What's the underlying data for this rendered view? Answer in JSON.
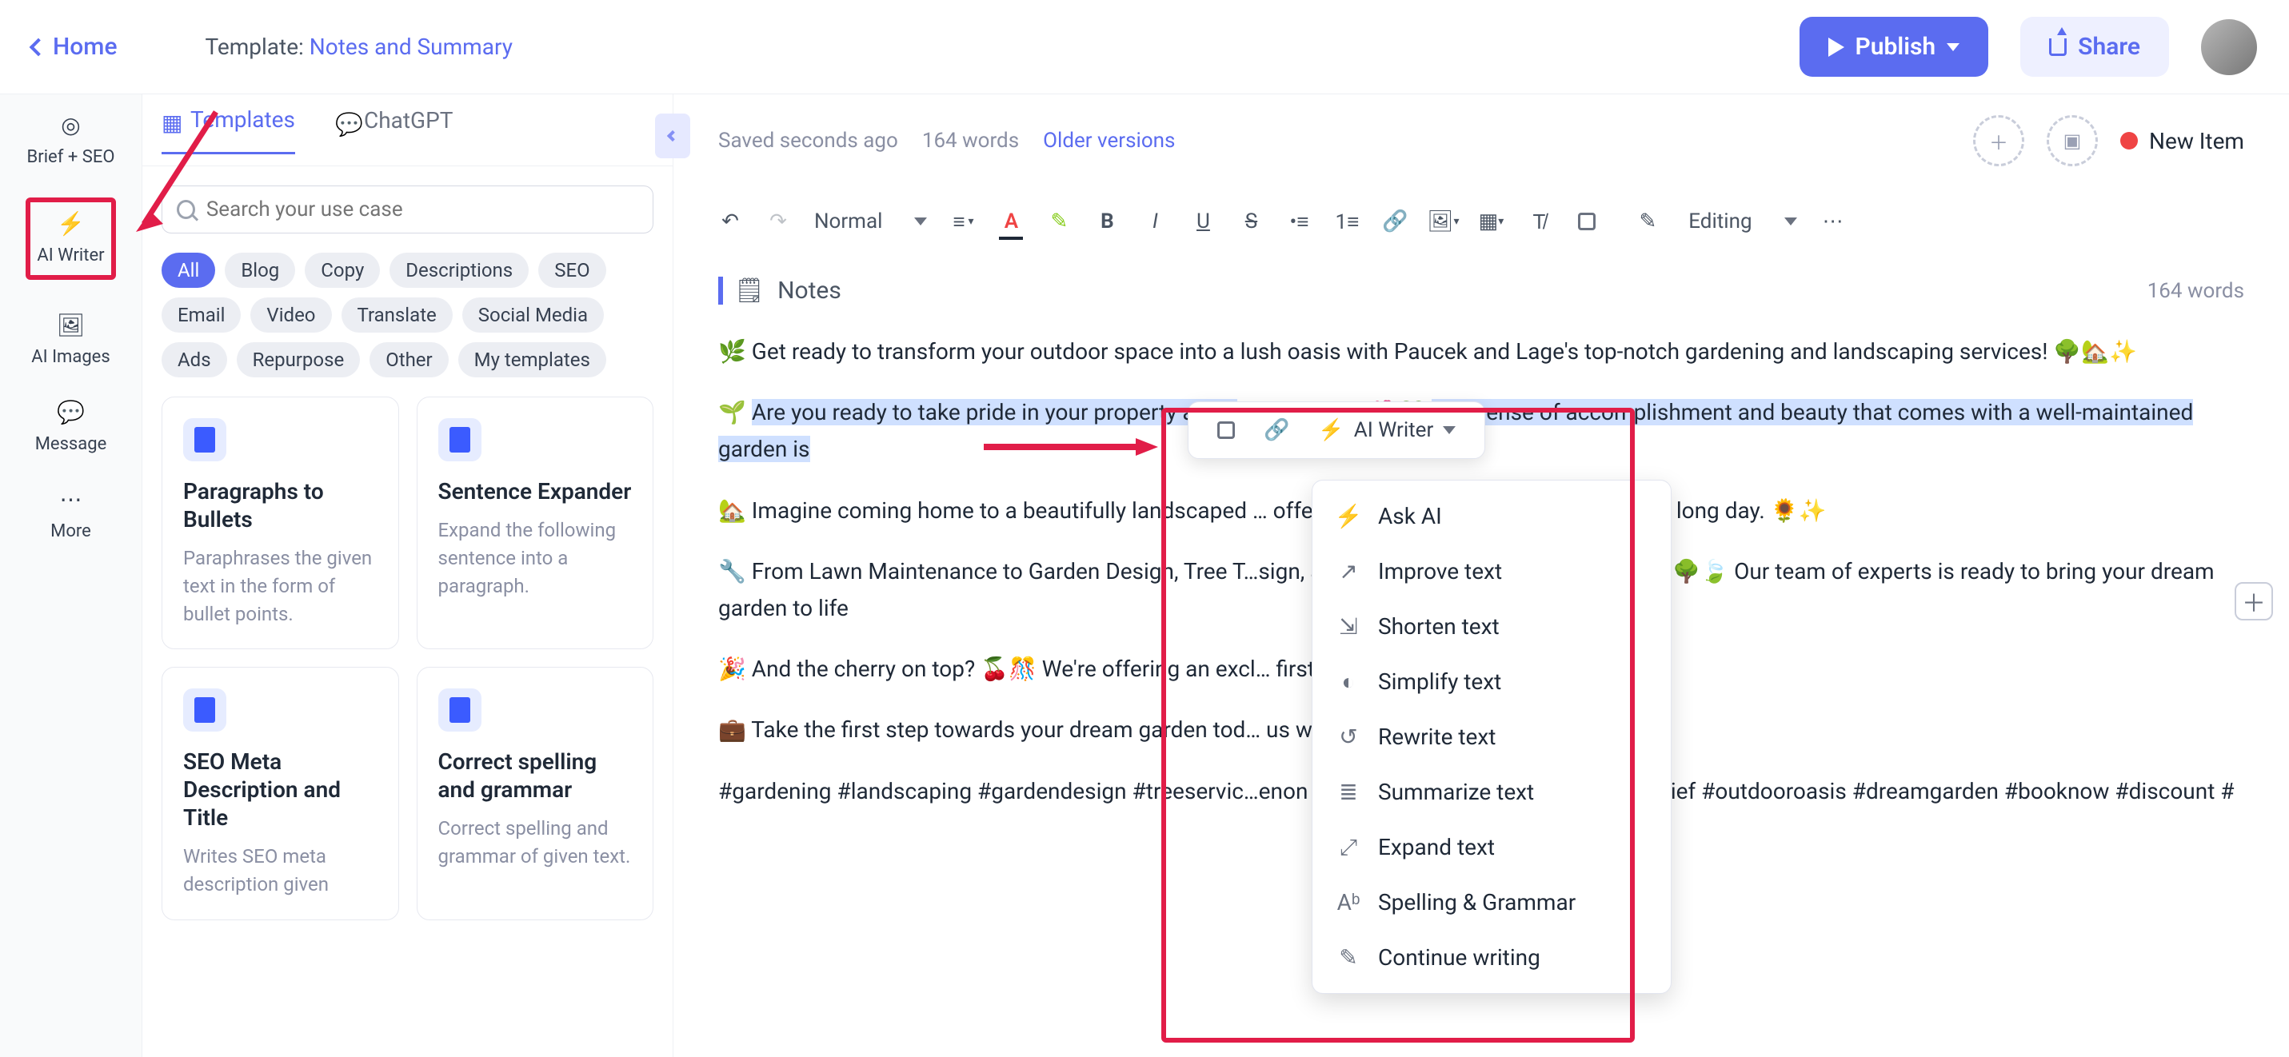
{
  "header": {
    "home": "Home",
    "template_prefix": "Template: ",
    "template_name": "Notes and Summary",
    "publish": "Publish",
    "share": "Share"
  },
  "rail": {
    "brief": "Brief + SEO",
    "writer": "AI Writer",
    "images": "AI Images",
    "message": "Message",
    "more": "More"
  },
  "sidebar": {
    "tabs": {
      "templates": "Templates",
      "chatgpt": "ChatGPT"
    },
    "search_placeholder": "Search your use case",
    "chips": [
      "All",
      "Blog",
      "Copy",
      "Descriptions",
      "SEO",
      "Email",
      "Video",
      "Translate",
      "Social Media",
      "Ads",
      "Repurpose",
      "Other",
      "My templates"
    ],
    "cards": [
      {
        "title": "Paragraphs to Bullets",
        "desc": "Paraphrases the given text in the form of bullet points."
      },
      {
        "title": "Sentence Expander",
        "desc": "Expand the following sentence into a paragraph."
      },
      {
        "title": "SEO Meta Description and Title",
        "desc": "Writes SEO meta description given"
      },
      {
        "title": "Correct spelling and grammar",
        "desc": "Correct spelling and grammar of given text."
      }
    ]
  },
  "main": {
    "saved": "Saved seconds ago",
    "word_count_top": "164 words",
    "older": "Older versions",
    "new_item": "New Item",
    "style_select": "Normal",
    "editing": "Editing",
    "section": "Notes",
    "word_count_section": "164 words",
    "p1": "🌿 Get ready to transform your outdoor space into a lush oasis with Paucek and Lage's top-notch gardening and landscaping services! 🌳🏡✨",
    "p2a": "🌱 ",
    "p2_hl": "Are you ready to take pride in your property and e",
    "p2b": "…landscape? 🌺💚 ",
    "p2_hl2": "The sense of accomplishment and beauty that comes with a well-maintained garden is",
    "p3": "🏡 Imagine coming home to a beautifully landscaped … offers relaxation and stress relief after a long day. 🌻✨",
    "p4": "🔧 From Lawn Maintenance to Garden Design, Tree T…sign, and Mowing, we've got you covered. 🌳🍃 Our team of experts is ready to bring your dream garden to life",
    "p5": "🎉 And the cherry on top? 🍒🎊 We're offering an excl… first booking! 💰🤩",
    "p6": "💼 Take the first step towards your dream garden tod… us work our magic! ✨🌸",
    "p7": "#gardening #landscaping #gardendesign #treeservic…enon #greenthumb #tranquility #stressrelief #outdooroasis #dreamgarden #booknow #discount #"
  },
  "float": {
    "writer": "AI Writer"
  },
  "dropdown": {
    "items": [
      "Ask AI",
      "Improve text",
      "Shorten text",
      "Simplify text",
      "Rewrite text",
      "Summarize text",
      "Expand text",
      "Spelling & Grammar",
      "Continue writing"
    ]
  }
}
